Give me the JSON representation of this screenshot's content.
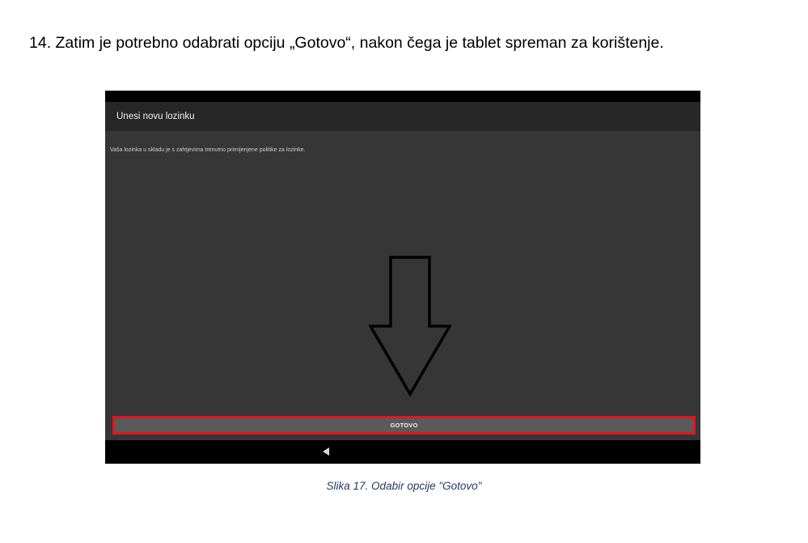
{
  "document": {
    "step_text": "14. Zatim je potrebno odabrati opciju „Gotovo“, nakon čega je tablet spreman za korištenje.",
    "caption": "Slika 17. Odabir opcije \"Gotovo\""
  },
  "screen": {
    "app_bar": {
      "title": "Unesi novu lozinku"
    },
    "info_text": "Vaša lozinka u skladu je s zahtjevima trenutno primijenjene politike za lozinke.",
    "done_button": {
      "label": "GOTOVO",
      "highlight_color": "#e0161b"
    },
    "nav_bar": {
      "back_icon": "back-triangle-icon"
    },
    "annotation_arrow": {
      "icon": "down-arrow-outline-icon",
      "color": "#000000"
    }
  },
  "colors": {
    "screen_background": "#363636",
    "app_bar_background": "#272727",
    "button_background": "#5a5a5a",
    "caption_color": "#1f3a5f"
  }
}
